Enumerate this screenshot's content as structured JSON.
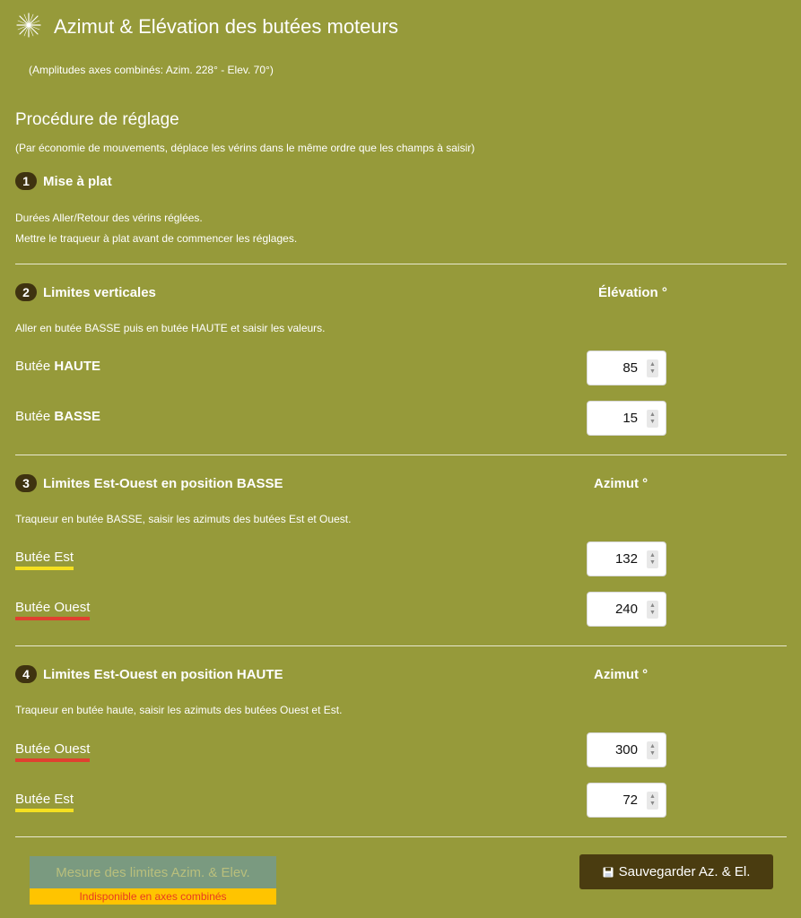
{
  "header": {
    "title": "Azimut & Elévation des butées moteurs",
    "subtitle": "(Amplitudes axes combinés: Azim. 228° - Elev. 70°)"
  },
  "procedure": {
    "title": "Procédure de réglage",
    "note": "(Par économie de mouvements, déplace les vérins dans le même ordre que les champs à saisir)"
  },
  "step1": {
    "num": "1",
    "title": "Mise à plat",
    "line1": "Durées Aller/Retour des vérins réglées.",
    "line2": "Mettre le traqueur à plat avant de commencer les réglages."
  },
  "step2": {
    "num": "2",
    "title": "Limites verticales",
    "col": "Élévation °",
    "desc": "Aller en butée BASSE puis en butée HAUTE et saisir les valeurs.",
    "row1_prefix": "Butée ",
    "row1_bold": "HAUTE",
    "row1_value": "85",
    "row2_prefix": "Butée ",
    "row2_bold": "BASSE",
    "row2_value": "15"
  },
  "step3": {
    "num": "3",
    "title": "Limites Est-Ouest en position BASSE",
    "col": "Azimut °",
    "desc": "Traqueur en butée BASSE, saisir les azimuts des butées Est et Ouest.",
    "row1_label": "Butée Est",
    "row1_value": "132",
    "row2_label": "Butée Ouest",
    "row2_value": "240"
  },
  "step4": {
    "num": "4",
    "title": "Limites Est-Ouest en position HAUTE",
    "col": "Azimut °",
    "desc": "Traqueur en butée haute, saisir les azimuts des butées Ouest et Est.",
    "row1_label": "Butée Ouest",
    "row1_value": "300",
    "row2_label": "Butée Est",
    "row2_value": "72"
  },
  "actions": {
    "measure_label": "Mesure des limites Azim. & Elev.",
    "measure_note": "Indisponible en axes combinés",
    "save_label": "Sauvegarder Az. & El."
  },
  "colors": {
    "background": "#969a3a",
    "east_underline": "#f5e020",
    "west_underline": "#e04030",
    "save_button": "#4a3c10"
  },
  "icons": {
    "header": "sun-star-icon",
    "save": "floppy-disk-icon"
  }
}
